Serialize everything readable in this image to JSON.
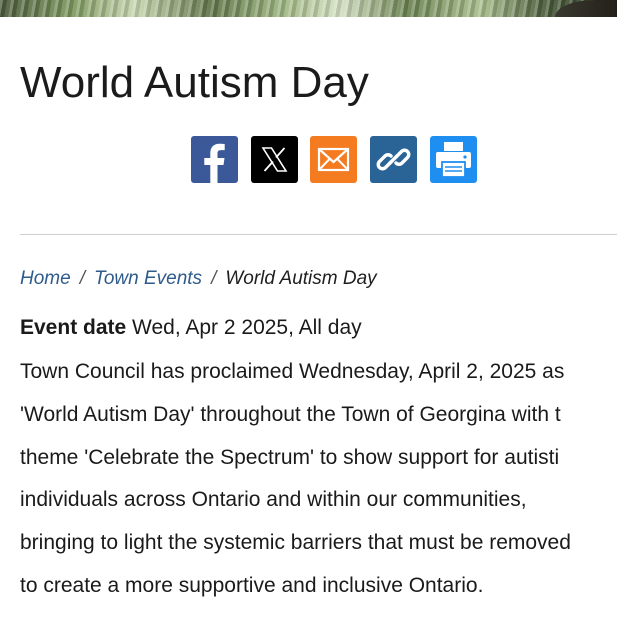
{
  "page": {
    "title": "World Autism Day"
  },
  "share": {
    "buttons": [
      {
        "name": "facebook",
        "icon": "facebook-icon",
        "color": "#3b5998"
      },
      {
        "name": "x",
        "icon": "x-icon",
        "color": "#000000"
      },
      {
        "name": "email",
        "icon": "envelope-icon",
        "color": "#f47b20"
      },
      {
        "name": "copy-link",
        "icon": "link-icon",
        "color": "#2a6496"
      },
      {
        "name": "print",
        "icon": "printer-icon",
        "color": "#1f8ef1"
      }
    ]
  },
  "breadcrumb": {
    "home": "Home",
    "separator": "/",
    "events": "Town Events",
    "current": "World Autism Day"
  },
  "event": {
    "date_label": "Event date",
    "date_value": "Wed, Apr 2 2025, All day"
  },
  "body": {
    "lines": [
      "Town Council has proclaimed Wednesday, April 2, 2025 as",
      "'World Autism Day' throughout the Town of Georgina with t",
      "theme 'Celebrate the Spectrum' to show support for autisti",
      "individuals across Ontario and within our communities,",
      "bringing to light the systemic barriers that must be removed",
      "to create a more supportive and inclusive Ontario."
    ]
  },
  "colors": {
    "link": "#2f5b8c",
    "divider": "#cfcfcf"
  }
}
